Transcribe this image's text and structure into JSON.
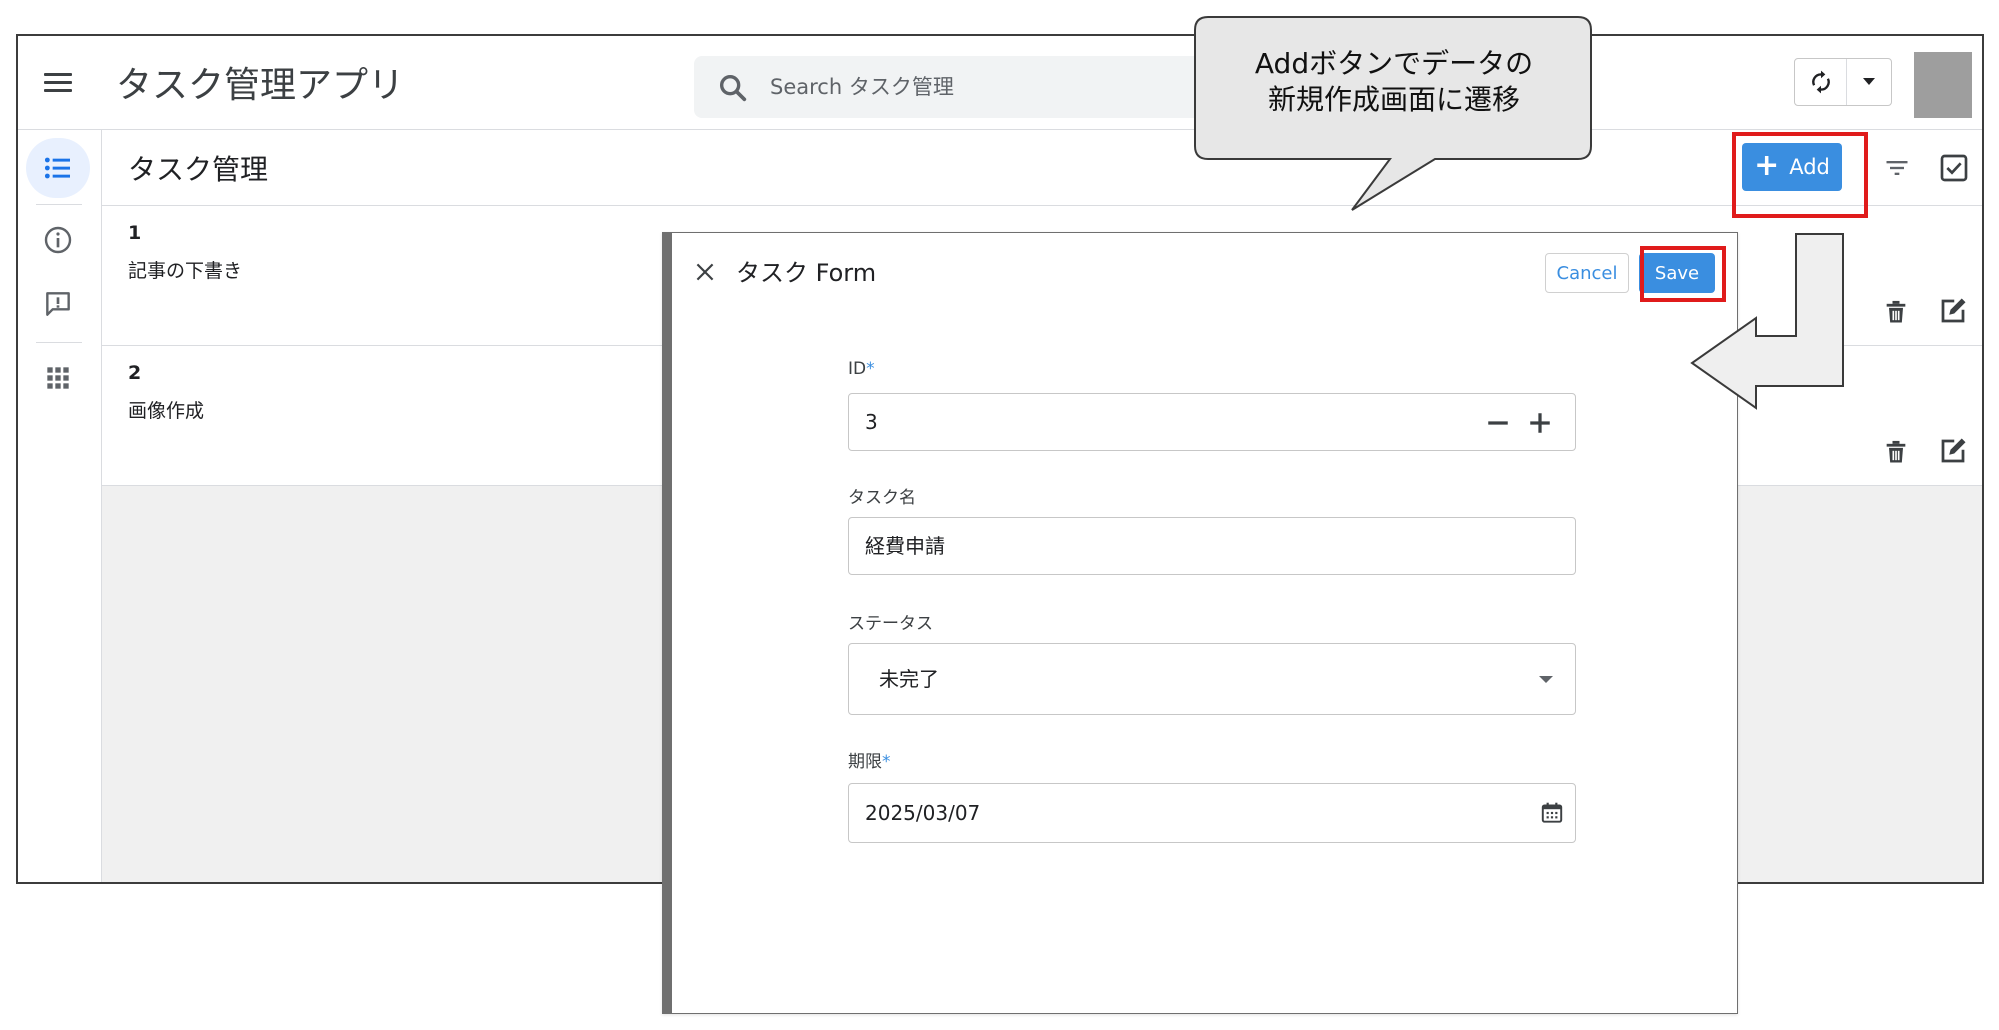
{
  "app": {
    "title": "タスク管理アプリ",
    "search_placeholder": "Search タスク管理"
  },
  "sidenav": {
    "items": [
      {
        "icon": "list-icon",
        "active": true
      },
      {
        "icon": "info-icon"
      },
      {
        "icon": "feedback-icon"
      },
      {
        "icon": "apps-grid-icon"
      }
    ]
  },
  "view": {
    "title": "タスク管理",
    "add_label": "Add",
    "rows": [
      {
        "id": "1",
        "name": "記事の下書き"
      },
      {
        "id": "2",
        "name": "画像作成"
      }
    ]
  },
  "form": {
    "title": "タスク Form",
    "cancel_label": "Cancel",
    "save_label": "Save",
    "fields": {
      "id": {
        "label": "ID",
        "required_mark": "*",
        "value": "3"
      },
      "name": {
        "label": "タスク名",
        "value": "経費申請"
      },
      "status": {
        "label": "ステータス",
        "value": "未完了"
      },
      "due": {
        "label": "期限",
        "required_mark": "*",
        "value": "2025/03/07"
      }
    }
  },
  "annotation": {
    "callout_line1": "Addボタンでデータの",
    "callout_line2": "新規作成画面に遷移"
  },
  "colors": {
    "accent": "#3a8ee0",
    "highlight": "#e01b1b",
    "nav_active_bg": "#e8f0fe"
  }
}
